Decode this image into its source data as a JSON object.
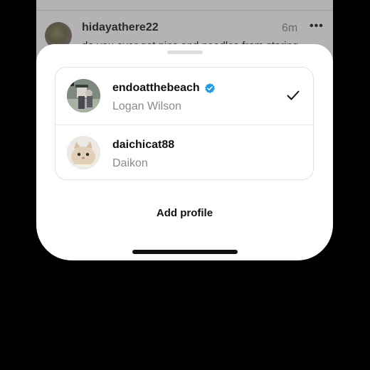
{
  "feed": {
    "username": "hidayathere22",
    "time": "6m",
    "more_label": "•••",
    "text": "do you ever get pins and needles from staring"
  },
  "sheet": {
    "profiles": [
      {
        "username": "endoatthebeach",
        "full_name": "Logan Wilson",
        "verified": true,
        "selected": true
      },
      {
        "username": "daichicat88",
        "full_name": "Daikon",
        "verified": false,
        "selected": false
      }
    ],
    "add_profile_label": "Add profile"
  },
  "colors": {
    "verified_blue": "#1d9bf0",
    "sheet_background": "#ffffff",
    "dim_overlay": "#b3b3b3"
  },
  "icons": {
    "verified": "verified-badge-icon",
    "check": "checkmark-icon",
    "more": "more-horizontal-icon"
  }
}
